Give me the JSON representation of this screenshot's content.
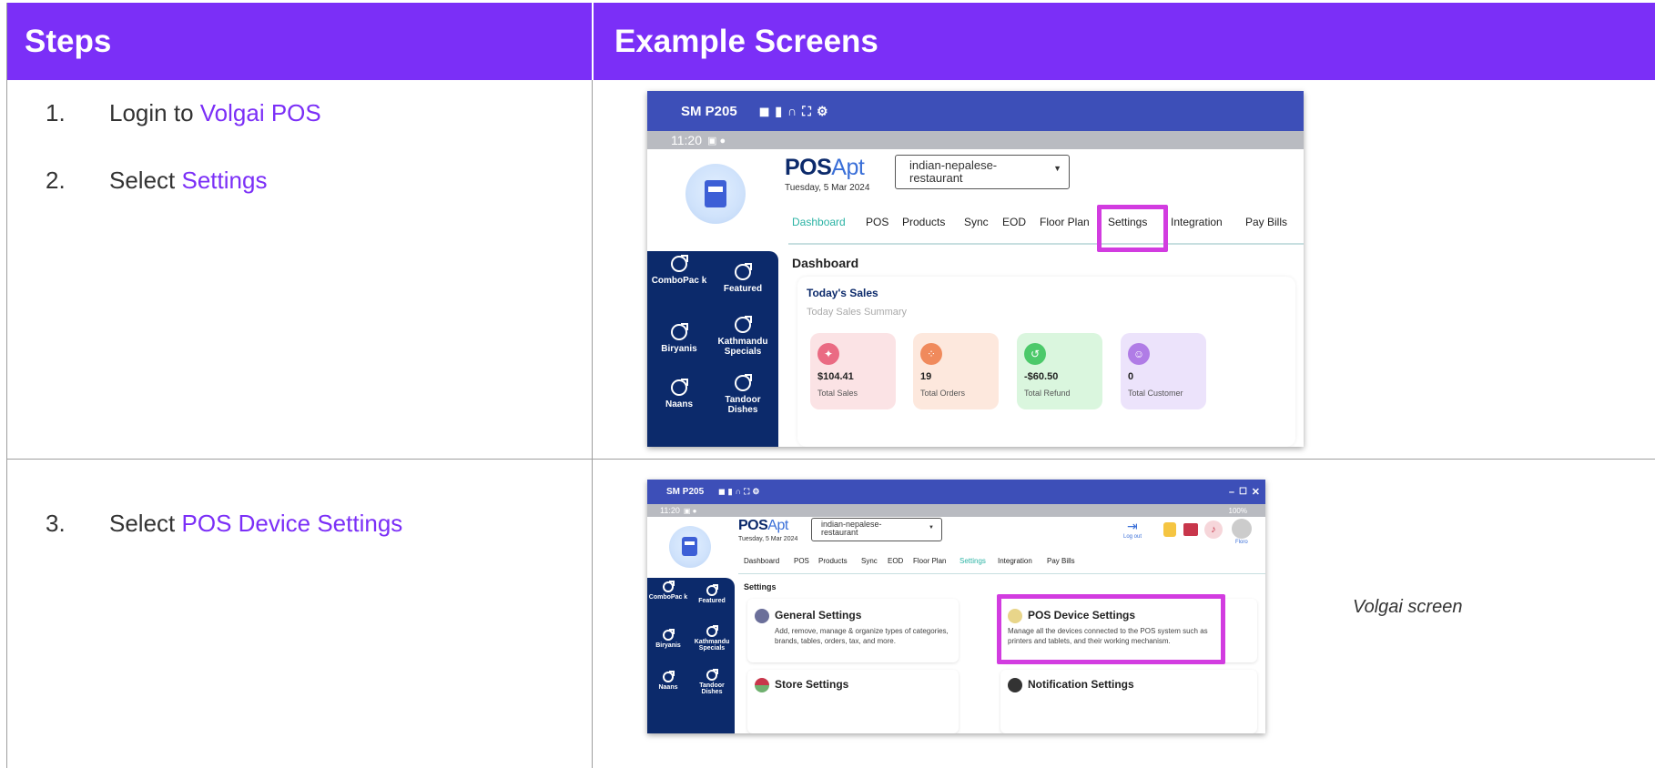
{
  "table": {
    "header_steps": "Steps",
    "header_examples": "Example Screens"
  },
  "steps": [
    {
      "num": "1.",
      "text": "Login to ",
      "link": "Volgai POS"
    },
    {
      "num": "2.",
      "text": "Select ",
      "link": "Settings"
    },
    {
      "num": "3.",
      "text": "Select ",
      "link": "POS Device Settings"
    }
  ],
  "caption": "Volgai screen",
  "colors": {
    "header_bg": "#7b2ff7",
    "link": "#7b2ff7",
    "app_bar": "#3d4fb8",
    "sidebar": "#0c2a6b",
    "highlight": "#d23ce0"
  },
  "screen1": {
    "device": "SM P205",
    "toolbar_icons": [
      "camera-icon",
      "video-icon",
      "headset-icon",
      "fullscreen-icon",
      "gear-icon"
    ],
    "time": "11:20",
    "logo_pos": "POS",
    "logo_apt": "Apt",
    "date": "Tuesday, 5 Mar 2024",
    "store": "indian-nepalese-restaurant",
    "nav": [
      "Dashboard",
      "POS",
      "Products",
      "Sync",
      "EOD",
      "Floor Plan",
      "Settings",
      "Integration",
      "Pay Bills"
    ],
    "active_nav": "Dashboard",
    "categories": [
      "ComboPac k",
      "Featured",
      "Biryanis",
      "Kathmandu Specials",
      "Naans",
      "Tandoor Dishes"
    ],
    "section_title": "Dashboard",
    "sales_title": "Today's Sales",
    "sales_subtitle": "Today Sales Summary",
    "cards": [
      {
        "value": "$104.41",
        "label": "Total Sales"
      },
      {
        "value": "19",
        "label": "Total Orders"
      },
      {
        "value": "-$60.50",
        "label": "Total Refund"
      },
      {
        "value": "0",
        "label": "Total Customer"
      }
    ]
  },
  "screen2": {
    "device": "SM P205",
    "time": "11:20",
    "status_right": "100%",
    "logo_pos": "POS",
    "logo_apt": "Apt",
    "date": "Tuesday, 5 Mar 2024",
    "store": "indian-nepalese-restaurant",
    "logout": "Log out",
    "user": "Floro",
    "nav": [
      "Dashboard",
      "POS",
      "Products",
      "Sync",
      "EOD",
      "Floor Plan",
      "Settings",
      "Integration",
      "Pay Bills"
    ],
    "active_nav": "Settings",
    "categories": [
      "ComboPac k",
      "Featured",
      "Biryanis",
      "Kathmandu Specials",
      "Naans",
      "Tandoor Dishes"
    ],
    "section_title": "Settings",
    "general_title": "General Settings",
    "general_desc": "Add, remove, manage & organize types of categories, brands, tables, orders, tax, and more.",
    "device_title": "POS Device Settings",
    "device_desc": "Manage all the devices connected to the POS system such as printers and tablets, and their working mechanism.",
    "store_title": "Store Settings",
    "notif_title": "Notification Settings"
  }
}
